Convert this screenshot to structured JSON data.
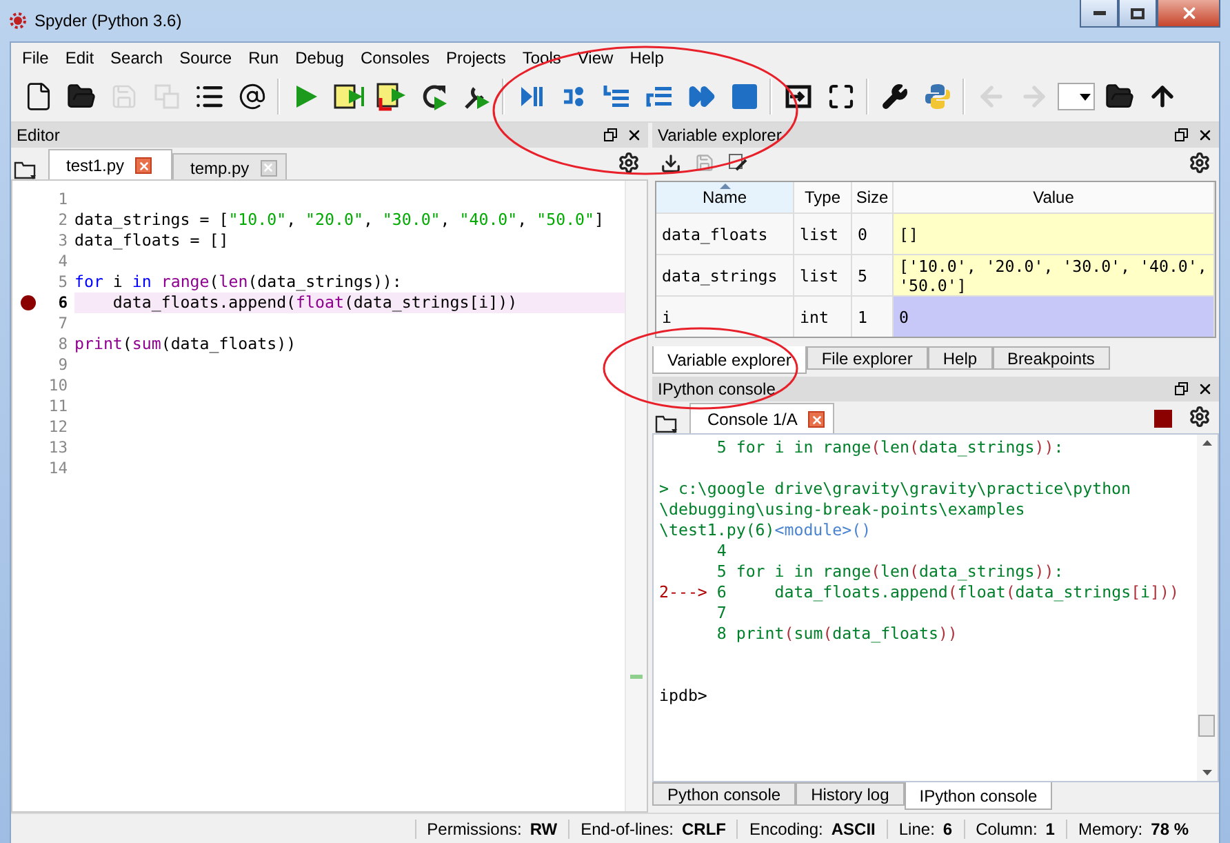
{
  "window": {
    "title": "Spyder (Python 3.6)"
  },
  "menu": [
    "File",
    "Edit",
    "Search",
    "Source",
    "Run",
    "Debug",
    "Consoles",
    "Projects",
    "Tools",
    "View",
    "Help"
  ],
  "toolbar": [
    {
      "kind": "new-file",
      "disabled": false
    },
    {
      "kind": "open",
      "disabled": false
    },
    {
      "kind": "save",
      "disabled": true
    },
    {
      "kind": "save-all",
      "disabled": true
    },
    {
      "kind": "list",
      "disabled": false
    },
    {
      "kind": "at",
      "disabled": false
    },
    {
      "kind": "separator"
    },
    {
      "kind": "run",
      "disabled": false
    },
    {
      "kind": "run-cell",
      "disabled": false
    },
    {
      "kind": "run-cell-advance",
      "disabled": false
    },
    {
      "kind": "rerun",
      "disabled": false
    },
    {
      "kind": "debug",
      "disabled": false
    },
    {
      "kind": "separator"
    },
    {
      "kind": "debug-step",
      "disabled": false
    },
    {
      "kind": "step-over",
      "disabled": false
    },
    {
      "kind": "step-into",
      "disabled": false
    },
    {
      "kind": "step-return",
      "disabled": false
    },
    {
      "kind": "continue",
      "disabled": false
    },
    {
      "kind": "stop",
      "disabled": false
    },
    {
      "kind": "separator"
    },
    {
      "kind": "maximize-pane",
      "disabled": false
    },
    {
      "kind": "fullscreen",
      "disabled": false
    },
    {
      "kind": "separator"
    },
    {
      "kind": "wrench",
      "disabled": false
    },
    {
      "kind": "python",
      "disabled": false
    },
    {
      "kind": "separator"
    },
    {
      "kind": "back",
      "disabled": true
    },
    {
      "kind": "forward",
      "disabled": true
    },
    {
      "kind": "combo",
      "disabled": false
    },
    {
      "kind": "open",
      "disabled": false
    },
    {
      "kind": "up",
      "disabled": false
    }
  ],
  "editor": {
    "title": "Editor",
    "tabs": [
      {
        "label": "test1.py",
        "selected": true
      },
      {
        "label": "temp.py",
        "selected": false
      }
    ],
    "lines": [
      {
        "number": "1",
        "breakpoint": false,
        "current": false
      },
      {
        "number": "2",
        "breakpoint": false,
        "current": false,
        "tokens": [
          {
            "text": "data_strings = [",
            "kind": "plain"
          },
          {
            "text": "\"10.0\"",
            "kind": "string"
          },
          {
            "text": ", ",
            "kind": "plain"
          },
          {
            "text": "\"20.0\"",
            "kind": "string"
          },
          {
            "text": ", ",
            "kind": "plain"
          },
          {
            "text": "\"30.0\"",
            "kind": "string"
          },
          {
            "text": ", ",
            "kind": "plain"
          },
          {
            "text": "\"40.0\"",
            "kind": "string"
          },
          {
            "text": ", ",
            "kind": "plain"
          },
          {
            "text": "\"50.0\"",
            "kind": "string"
          },
          {
            "text": "]",
            "kind": "plain"
          }
        ]
      },
      {
        "number": "3",
        "breakpoint": false,
        "current": false,
        "tokens": [
          {
            "text": "data_floats = []",
            "kind": "plain"
          }
        ]
      },
      {
        "number": "4",
        "breakpoint": false,
        "current": false
      },
      {
        "number": "5",
        "breakpoint": false,
        "current": false,
        "tokens": [
          {
            "text": "for",
            "kind": "keyword"
          },
          {
            "text": " i ",
            "kind": "plain"
          },
          {
            "text": "in ",
            "kind": "keyword"
          },
          {
            "text": "range",
            "kind": "builtin"
          },
          {
            "text": "(",
            "kind": "plain"
          },
          {
            "text": "len",
            "kind": "builtin"
          },
          {
            "text": "(data_strings)):",
            "kind": "plain"
          }
        ]
      },
      {
        "number": "6",
        "breakpoint": true,
        "current": true,
        "tokens": [
          {
            "text": "    data_floats.append(",
            "kind": "plain"
          },
          {
            "text": "float",
            "kind": "builtin"
          },
          {
            "text": "(data_strings[i]))",
            "kind": "plain"
          }
        ]
      },
      {
        "number": "7",
        "breakpoint": false,
        "current": false
      },
      {
        "number": "8",
        "breakpoint": false,
        "current": false,
        "tokens": [
          {
            "text": "print",
            "kind": "builtin"
          },
          {
            "text": "(",
            "kind": "plain"
          },
          {
            "text": "sum",
            "kind": "builtin"
          },
          {
            "text": "(data_floats))",
            "kind": "plain"
          }
        ]
      },
      {
        "number": "9",
        "breakpoint": false,
        "current": false
      },
      {
        "number": "10",
        "breakpoint": false,
        "current": false
      },
      {
        "number": "11",
        "breakpoint": false,
        "current": false
      },
      {
        "number": "12",
        "breakpoint": false,
        "current": false
      },
      {
        "number": "13",
        "breakpoint": false,
        "current": false
      },
      {
        "number": "14",
        "breakpoint": false,
        "current": false
      }
    ]
  },
  "variable_explorer": {
    "title": "Variable explorer",
    "columns": [
      "Name",
      "Type",
      "Size",
      "Value"
    ],
    "rows": [
      {
        "name": "data_floats",
        "type": "list",
        "size": "0",
        "value": "[]",
        "color": "#ffffc6"
      },
      {
        "name": "data_strings",
        "type": "list",
        "size": "5",
        "value": "['10.0', '20.0', '30.0', '40.0', '50.0']",
        "color": "#ffffc6"
      },
      {
        "name": "i",
        "type": "int",
        "size": "1",
        "value": "0",
        "color": "#c8c8f8"
      }
    ],
    "tabs": [
      {
        "label": "Variable explorer",
        "selected": true
      },
      {
        "label": "File explorer",
        "selected": false
      },
      {
        "label": "Help",
        "selected": false
      },
      {
        "label": "Breakpoints",
        "selected": false
      }
    ]
  },
  "console": {
    "title": "IPython console",
    "tabs": [
      {
        "label": "Console 1/A",
        "selected": true
      }
    ],
    "blocks": [
      {
        "lines": [
          {
            "tokens": [
              {
                "text": "      5 for i in range",
                "kind": "text"
              },
              {
                "text": "(",
                "kind": "paren"
              },
              {
                "text": "len",
                "kind": "text"
              },
              {
                "text": "(",
                "kind": "paren"
              },
              {
                "text": "data_strings",
                "kind": "text"
              },
              {
                "text": "))",
                "kind": "paren"
              },
              {
                "text": ":",
                "kind": "text"
              }
            ]
          }
        ]
      },
      {
        "lines": [
          {
            "tokens": [
              {
                "text": "> c:\\google drive\\gravity\\gravity\\practice\\python",
                "kind": "text"
              }
            ]
          },
          {
            "tokens": [
              {
                "text": "\\debugging\\using-break-points\\examples",
                "kind": "text"
              }
            ]
          },
          {
            "tokens": [
              {
                "text": "\\test1.py(6)",
                "kind": "text"
              },
              {
                "text": "<module>()",
                "kind": "module"
              }
            ]
          },
          {
            "tokens": [
              {
                "text": "      4",
                "kind": "text"
              }
            ]
          },
          {
            "tokens": [
              {
                "text": "      5 for i in range",
                "kind": "text"
              },
              {
                "text": "(",
                "kind": "paren"
              },
              {
                "text": "len",
                "kind": "text"
              },
              {
                "text": "(",
                "kind": "paren"
              },
              {
                "text": "data_strings",
                "kind": "text"
              },
              {
                "text": "))",
                "kind": "paren"
              },
              {
                "text": ":",
                "kind": "text"
              }
            ]
          },
          {
            "tokens": [
              {
                "text": "2---> ",
                "kind": "marker"
              },
              {
                "text": "6     data_floats.append",
                "kind": "text"
              },
              {
                "text": "(",
                "kind": "paren"
              },
              {
                "text": "float",
                "kind": "text"
              },
              {
                "text": "(",
                "kind": "paren"
              },
              {
                "text": "data_strings",
                "kind": "text"
              },
              {
                "text": "[",
                "kind": "paren"
              },
              {
                "text": "i",
                "kind": "text"
              },
              {
                "text": "]))",
                "kind": "paren"
              }
            ]
          },
          {
            "tokens": [
              {
                "text": "      7",
                "kind": "text"
              }
            ]
          },
          {
            "tokens": [
              {
                "text": "      8 print",
                "kind": "text"
              },
              {
                "text": "(",
                "kind": "paren"
              },
              {
                "text": "sum",
                "kind": "text"
              },
              {
                "text": "(",
                "kind": "paren"
              },
              {
                "text": "data_floats",
                "kind": "text"
              },
              {
                "text": "))",
                "kind": "paren"
              }
            ]
          }
        ]
      },
      {
        "lines": [
          {
            "tokens": [
              {
                "text": "ipdb>",
                "kind": "plain"
              }
            ]
          }
        ]
      }
    ],
    "bottom_tabs": [
      {
        "label": "Python console",
        "selected": false
      },
      {
        "label": "History log",
        "selected": false
      },
      {
        "label": "IPython console",
        "selected": true
      }
    ]
  },
  "status_bar": [
    {
      "label": "Permissions:",
      "value": "RW"
    },
    {
      "label": "End-of-lines:",
      "value": "CRLF"
    },
    {
      "label": "Encoding:",
      "value": "ASCII"
    },
    {
      "label": "Line:",
      "value": "6"
    },
    {
      "label": "Column:",
      "value": "1"
    },
    {
      "label": "Memory:",
      "value": "78 %"
    }
  ],
  "annotations": [
    {
      "kind": "ellipse",
      "color": "#e8202a"
    },
    {
      "kind": "ellipse",
      "color": "#e8202a"
    }
  ]
}
